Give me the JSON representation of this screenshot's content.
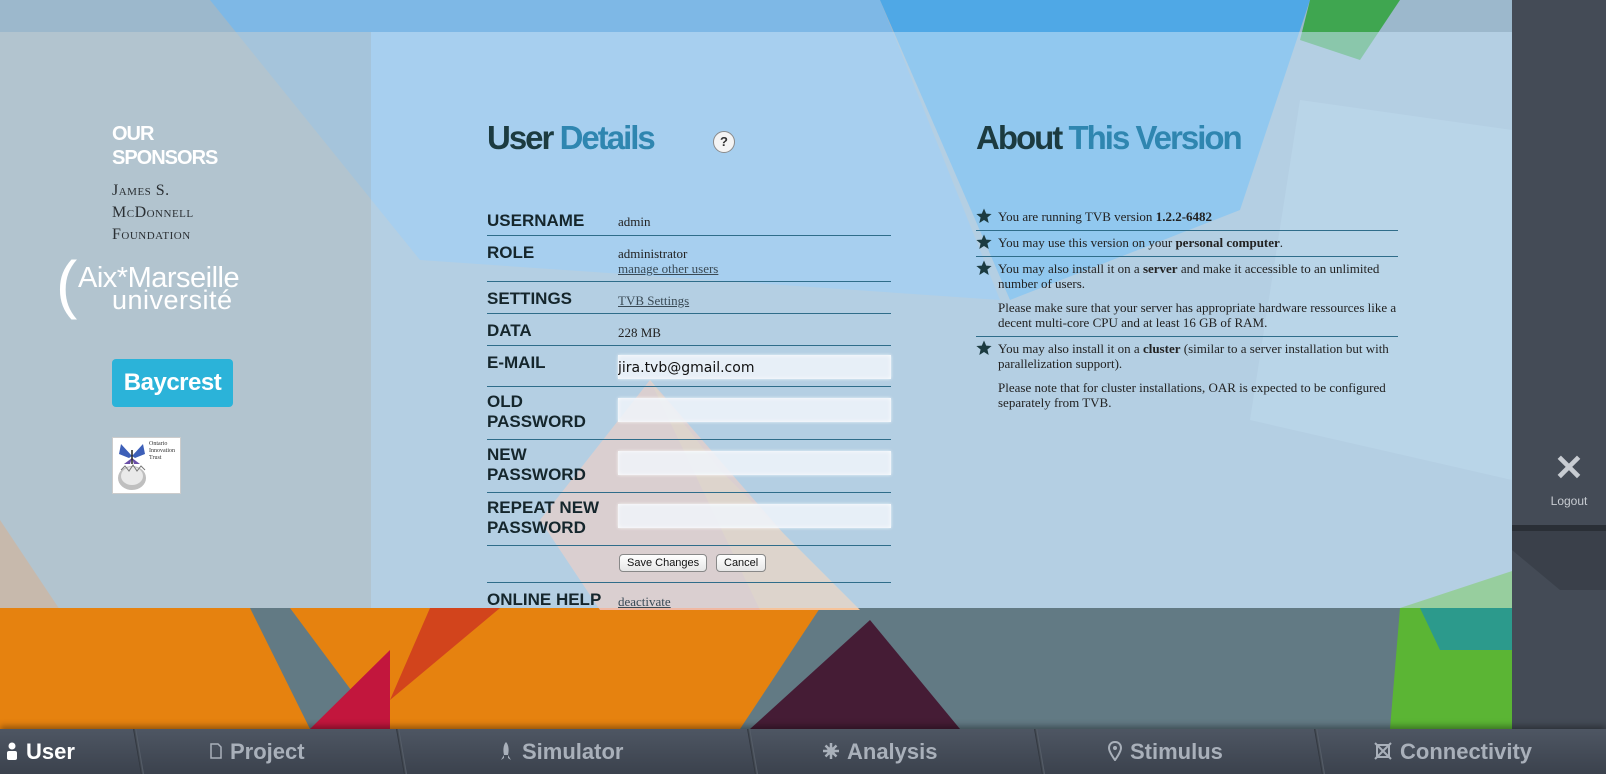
{
  "sponsors": {
    "title_line1": "Our",
    "title_line2": "Sponsors",
    "mcdonnell": [
      "James S.",
      "McDonnell",
      "Foundation"
    ],
    "amu_line1": "Aix*Marseille",
    "amu_line2": "université",
    "baycrest": "Baycrest",
    "oit": [
      "Ontario",
      "Innovation",
      "Trust"
    ]
  },
  "user_details": {
    "title_word1": "User",
    "title_word2": "Details",
    "help_glyph": "?",
    "username_label": "Username",
    "username_value": "admin",
    "role_label": "Role",
    "role_value": "administrator",
    "role_link": "manage other users",
    "settings_label": "Settings",
    "settings_link": "TVB Settings",
    "data_label": "Data",
    "data_value": "228 MB",
    "email_label": "E-mail",
    "email_value": "jira.tvb@gmail.com",
    "old_password_label_1": "Old",
    "old_password_label_2": "Password",
    "new_password_label_1": "New",
    "new_password_label_2": "Password",
    "repeat_password_label_1": "Repeat New",
    "repeat_password_label_2": "Password",
    "save_label": "Save Changes",
    "cancel_label": "Cancel",
    "online_help_label": "Online Help",
    "online_help_link": "deactivate"
  },
  "about": {
    "title_word1": "About",
    "title_word2": "This Version",
    "item1_pre": "You are running TVB version ",
    "item1_bold": "1.2.2-6482",
    "item2_pre": "You may use this version on your ",
    "item2_bold": "personal computer",
    "item2_post": ".",
    "item3_pre": "You may also install it on a ",
    "item3_bold": "server",
    "item3_post": " and make it accessible to an unlimited number of users.",
    "item3_note": "Please make sure that your server has appropriate hardware ressources like a decent multi-core CPU and at least 16 GB of RAM.",
    "item4_pre": "You may also install it on a ",
    "item4_bold": "cluster",
    "item4_post": " (similar to a server installation but with parallelization support).",
    "item4_note": "Please note that for cluster installations, OAR is expected to be configured separately from TVB."
  },
  "logout": {
    "glyph": "✕",
    "label": "Logout"
  },
  "nav": {
    "user": "User",
    "project": "Project",
    "simulator": "Simulator",
    "analysis": "Analysis",
    "stimulus": "Stimulus",
    "connectivity": "Connectivity"
  },
  "colors": {
    "title_dark": "#1c3b40",
    "title_accent": "#2f86b0",
    "baycrest": "#2bb3d9",
    "orange": "#e6820f",
    "green": "#5bb534",
    "nav_bg": "#444b56"
  }
}
